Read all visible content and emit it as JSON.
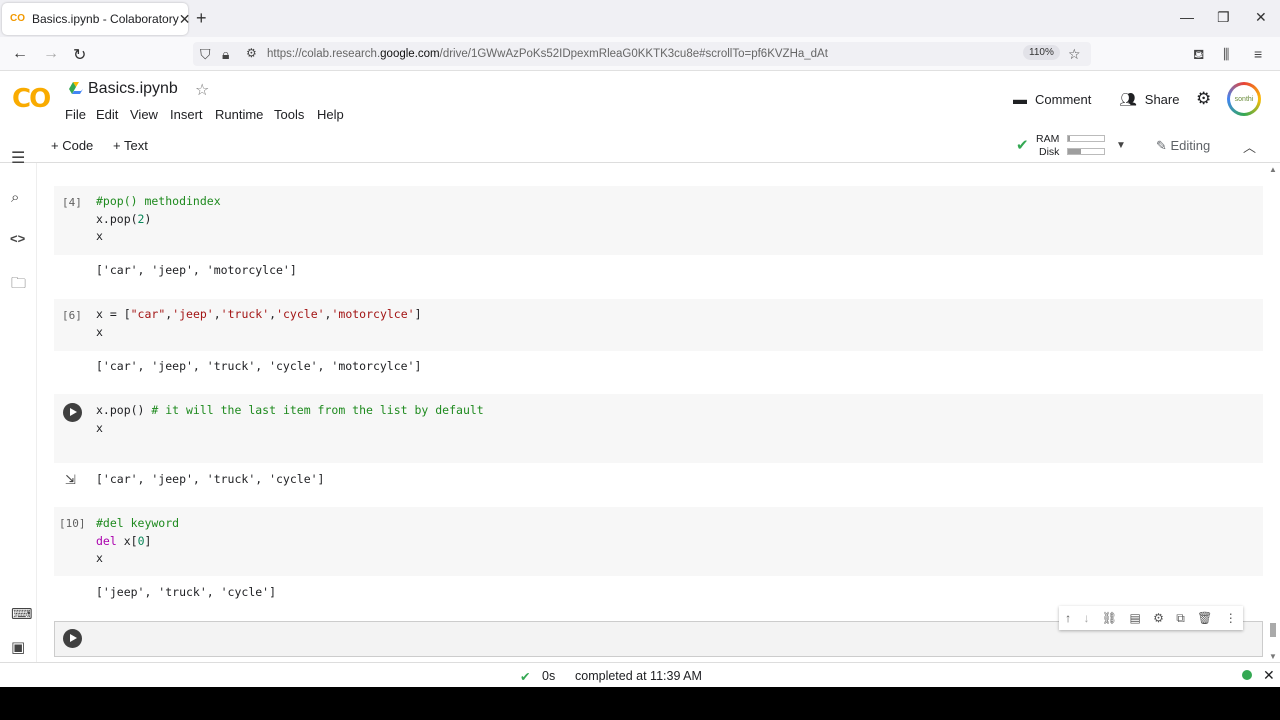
{
  "browser": {
    "tab_title": "Basics.ipynb - Colaboratory",
    "url_prefix": "https://colab.research.",
    "url_domain": "google.com",
    "url_rest": "/drive/1GWwAzPoKs52IDpexmRleaG0KKTK3cu8e#scrollTo=pf6KVZHa_dAt",
    "zoom": "110%"
  },
  "header": {
    "notebook_title": "Basics.ipynb",
    "menu": [
      "File",
      "Edit",
      "View",
      "Insert",
      "Runtime",
      "Tools",
      "Help"
    ],
    "comment_label": "Comment",
    "share_label": "Share",
    "avatar_text": "sonthi"
  },
  "toolbar": {
    "add_code": "+ Code",
    "add_text": "+ Text",
    "ram_label": "RAM",
    "disk_label": "Disk",
    "ram_usage": 0.05,
    "disk_usage": 0.35,
    "editing_label": "Editing"
  },
  "cells": [
    {
      "exec": "[4]",
      "code": [
        [
          {
            "t": "#pop() methodindex",
            "c": "cm"
          }
        ],
        [
          {
            "t": "x.pop(",
            "c": ""
          },
          {
            "t": "2",
            "c": "num"
          },
          {
            "t": ")",
            "c": ""
          }
        ],
        [
          {
            "t": "x",
            "c": ""
          }
        ]
      ],
      "output": "['car', 'jeep', 'motorcylce']"
    },
    {
      "exec": "[6]",
      "code": [
        [
          {
            "t": "x = [",
            "c": ""
          },
          {
            "t": "\"car\"",
            "c": "str"
          },
          {
            "t": ",",
            "c": ""
          },
          {
            "t": "'jeep'",
            "c": "str"
          },
          {
            "t": ",",
            "c": ""
          },
          {
            "t": "'truck'",
            "c": "str"
          },
          {
            "t": ",",
            "c": ""
          },
          {
            "t": "'cycle'",
            "c": "str"
          },
          {
            "t": ",",
            "c": ""
          },
          {
            "t": "'motorcylce'",
            "c": "str"
          },
          {
            "t": "]",
            "c": ""
          }
        ],
        [
          {
            "t": "x",
            "c": ""
          }
        ]
      ],
      "output": "['car', 'jeep', 'truck', 'cycle', 'motorcylce']"
    },
    {
      "exec": "",
      "code": [
        [
          {
            "t": "x.pop() ",
            "c": ""
          },
          {
            "t": "# it will the last item from the list by default",
            "c": "cm"
          }
        ],
        [
          {
            "t": "x",
            "c": ""
          }
        ]
      ],
      "output": "['car', 'jeep', 'truck', 'cycle']"
    },
    {
      "exec": "[10]",
      "code": [
        [
          {
            "t": "#del keyword",
            "c": "cm"
          }
        ],
        [
          {
            "t": "del",
            "c": "kw"
          },
          {
            "t": " x[",
            "c": ""
          },
          {
            "t": "0",
            "c": "num"
          },
          {
            "t": "]",
            "c": ""
          }
        ],
        [
          {
            "t": "x",
            "c": ""
          }
        ]
      ],
      "output": "['jeep', 'truck', 'cycle']"
    }
  ],
  "status": {
    "duration": "0s",
    "completed": "completed at 11:39 AM"
  }
}
